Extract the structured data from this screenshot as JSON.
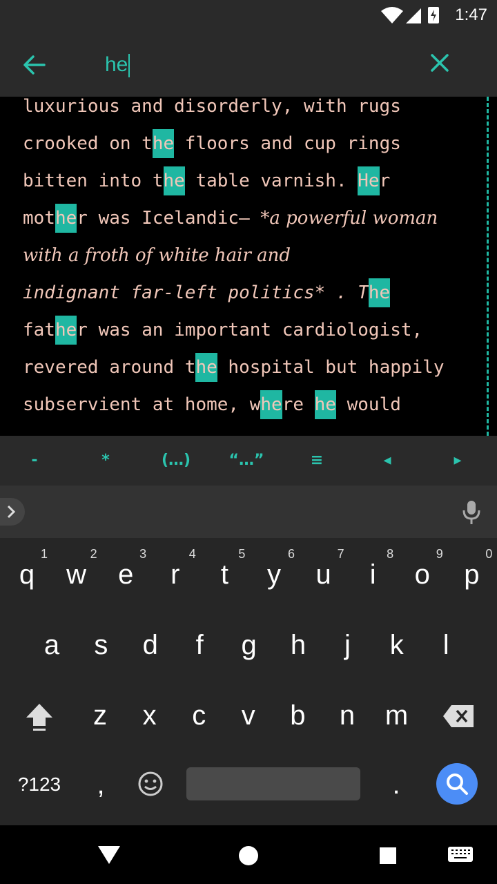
{
  "status": {
    "time": "1:47"
  },
  "search": {
    "query": "he"
  },
  "editor": {
    "lines": [
      {
        "text": "luxurious and disorderly, with rugs"
      },
      {
        "segs": [
          "crooked on t",
          "he",
          " floors and cup rings"
        ]
      },
      {
        "segs": [
          "bitten into t",
          "he",
          " table varnish. ",
          "He",
          "r"
        ]
      },
      {
        "segs": [
          "mot",
          "he",
          "r was Icelandic– ",
          "*a powerful woman"
        ]
      },
      {
        "text": "with a froth of white hair and"
      },
      {
        "segs": [
          "indignant far-left politics* . T",
          "he"
        ]
      },
      {
        "segs": [
          "fat",
          "he",
          "r was an important cardiologist,"
        ]
      },
      {
        "segs": [
          "revered around t",
          "he",
          " hospital but happily"
        ]
      },
      {
        "segs": [
          "subservient at home, w",
          "he",
          "re ",
          "he",
          " would"
        ]
      }
    ]
  },
  "md_toolbar": [
    "-",
    "*",
    "(…)",
    "“…”",
    "≡",
    "◂",
    "▸"
  ],
  "keyboard": {
    "row1": [
      {
        "k": "q",
        "h": "1"
      },
      {
        "k": "w",
        "h": "2"
      },
      {
        "k": "e",
        "h": "3"
      },
      {
        "k": "r",
        "h": "4"
      },
      {
        "k": "t",
        "h": "5"
      },
      {
        "k": "y",
        "h": "6"
      },
      {
        "k": "u",
        "h": "7"
      },
      {
        "k": "i",
        "h": "8"
      },
      {
        "k": "o",
        "h": "9"
      },
      {
        "k": "p",
        "h": "0"
      }
    ],
    "row2": [
      "a",
      "s",
      "d",
      "f",
      "g",
      "h",
      "j",
      "k",
      "l"
    ],
    "row3": [
      "z",
      "x",
      "c",
      "v",
      "b",
      "n",
      "m"
    ],
    "symbols_label": "?123",
    "comma": ",",
    "period": "."
  },
  "colors": {
    "accent": "#2bc4ae",
    "highlight": "#1fb7a2",
    "text": "#f1c7b9"
  }
}
